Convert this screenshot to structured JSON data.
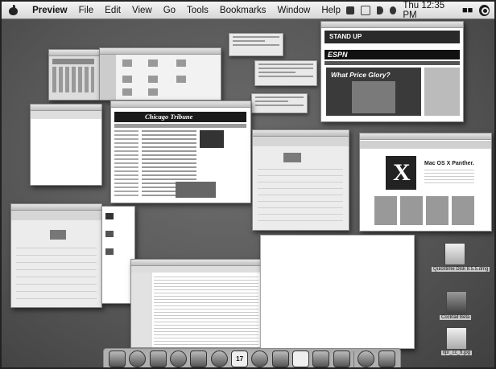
{
  "menubar": {
    "app_name": "Preview",
    "items": [
      "File",
      "Edit",
      "View",
      "Go",
      "Tools",
      "Bookmarks",
      "Window",
      "Help"
    ],
    "clock": "Thu 12:35 PM",
    "user": "👥"
  },
  "windows": {
    "chicago_masthead": "Chicago Tribune",
    "espn_banner": "ESPN",
    "espn_headline": "What Price Glory?",
    "standup_banner": "STAND UP",
    "panther_title": "Mac OS X Panther.",
    "panther_x": "X",
    "calendar_day": "17"
  },
  "desktop_icons": [
    {
      "label": "Quicktime Disk\n8.5.5.dmg"
    },
    {
      "label": "Cocktail Beta"
    },
    {
      "label": "itpr_cc_9.jpg"
    }
  ],
  "dock": {
    "items": [
      "finder",
      "safari",
      "mail",
      "ical",
      "itunes",
      "address-book",
      "preview",
      "system-prefs",
      "trash"
    ]
  }
}
